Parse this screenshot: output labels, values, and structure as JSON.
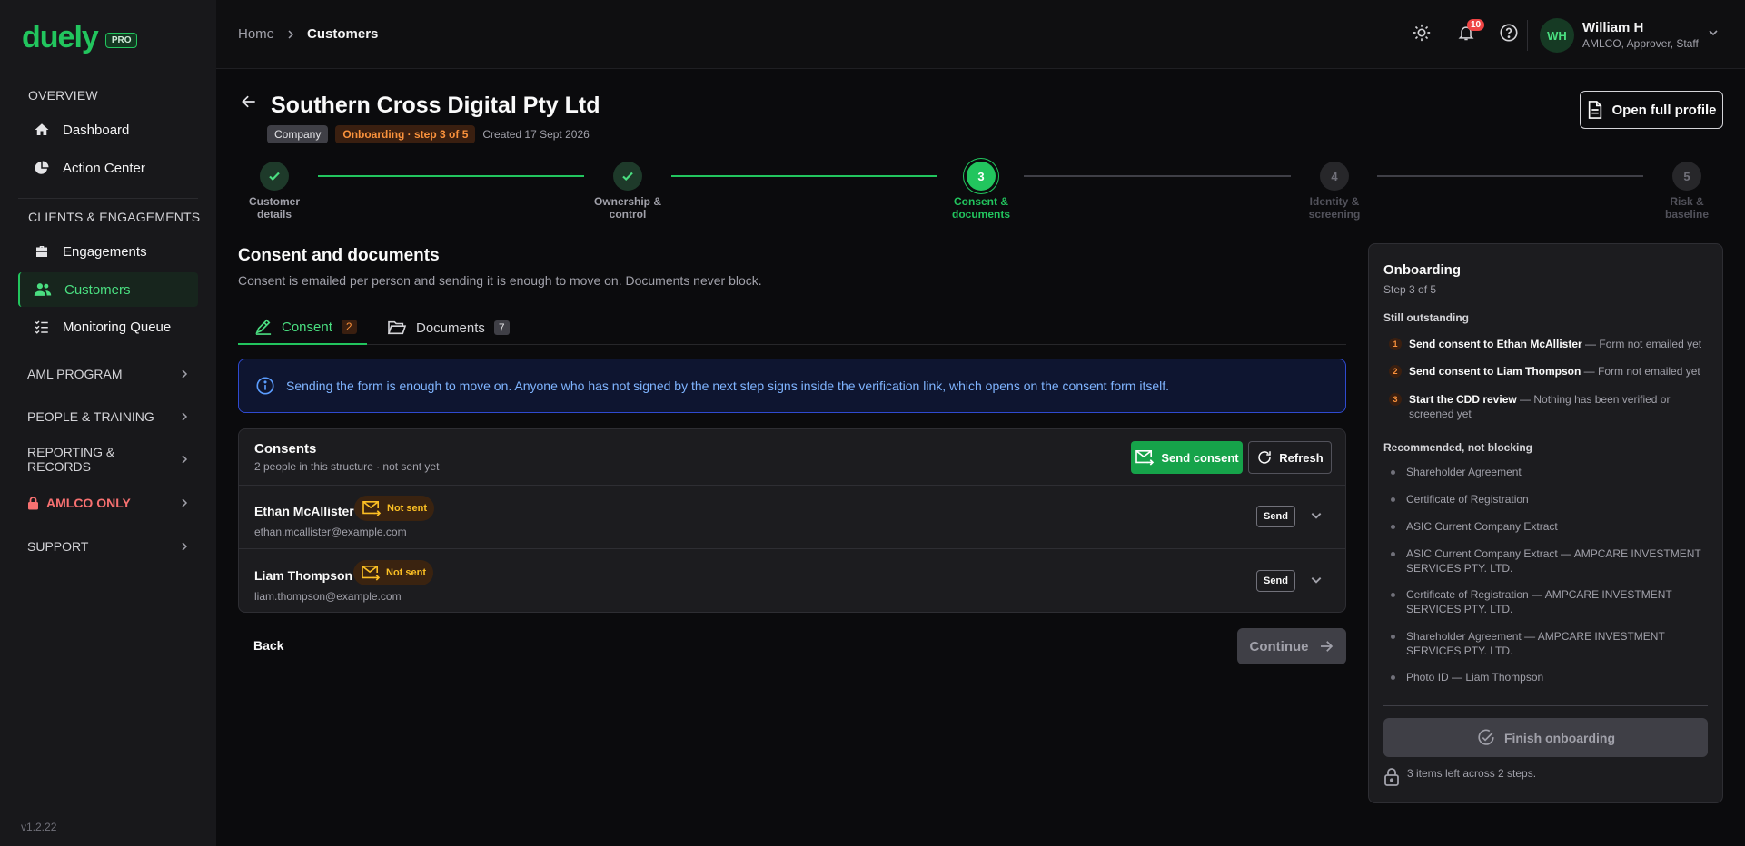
{
  "app": {
    "logo": "duely",
    "plan_badge": "PRO",
    "version": "v1.2.22"
  },
  "sidebar": {
    "overview_label": "OVERVIEW",
    "overview_items": [
      {
        "label": "Dashboard",
        "icon": "home-icon"
      },
      {
        "label": "Action Center",
        "icon": "pie-chart-icon"
      }
    ],
    "clients_label": "CLIENTS & ENGAGEMENTS",
    "clients_items": [
      {
        "label": "Engagements",
        "icon": "briefcase-icon"
      },
      {
        "label": "Customers",
        "icon": "users-icon",
        "active": true
      },
      {
        "label": "Monitoring Queue",
        "icon": "list-check-icon"
      }
    ],
    "groups": [
      {
        "label": "AML PROGRAM"
      },
      {
        "label": "PEOPLE & TRAINING"
      },
      {
        "label": "REPORTING & RECORDS"
      },
      {
        "label": "AMLCO ONLY",
        "locked": true
      },
      {
        "label": "SUPPORT"
      }
    ]
  },
  "header": {
    "breadcrumb": [
      "Home",
      "Customers"
    ],
    "notification_count": "10",
    "user": {
      "initials": "WH",
      "name": "William H",
      "roles": "AMLCO, Approver, Staff"
    }
  },
  "customer": {
    "name": "Southern Cross Digital Pty Ltd",
    "type": "Company",
    "status": "Onboarding · step 3 of 5",
    "created": "Created 17 Sept 2026",
    "open_profile_label": "Open full profile"
  },
  "stepper": {
    "steps": [
      {
        "number": "1",
        "label_line1": "Customer",
        "label_line2": "details",
        "state": "done"
      },
      {
        "number": "2",
        "label_line1": "Ownership &",
        "label_line2": "control",
        "state": "done"
      },
      {
        "number": "3",
        "label_line1": "Consent &",
        "label_line2": "documents",
        "state": "current"
      },
      {
        "number": "4",
        "label_line1": "Identity &",
        "label_line2": "screening",
        "state": "todo"
      },
      {
        "number": "5",
        "label_line1": "Risk &",
        "label_line2": "baseline",
        "state": "todo"
      }
    ]
  },
  "section": {
    "title": "Consent and documents",
    "subtitle": "Consent is emailed per person and sending it is enough to move on. Documents never block.",
    "tabs": [
      {
        "label": "Consent",
        "count": "2",
        "active": true
      },
      {
        "label": "Documents",
        "count": "7",
        "active": false
      }
    ],
    "info_banner": "Sending the form is enough to move on. Anyone who has not signed by the next step signs inside the verification link, which opens on the consent form itself."
  },
  "consents": {
    "title": "Consents",
    "subtitle": "2 people in this structure · not sent yet",
    "send_consent_label": "Send consent",
    "refresh_label": "Refresh",
    "people": [
      {
        "name": "Ethan McAllister",
        "status": "Not sent",
        "email": "ethan.mcallister@example.com",
        "send_label": "Send"
      },
      {
        "name": "Liam Thompson",
        "status": "Not sent",
        "email": "liam.thompson@example.com",
        "send_label": "Send"
      }
    ]
  },
  "footer": {
    "back_label": "Back",
    "continue_label": "Continue"
  },
  "panel": {
    "title": "Onboarding",
    "subtitle": "Step 3 of 5",
    "outstanding_heading": "Still outstanding",
    "outstanding": [
      {
        "num": "1",
        "title": "Send consent to Ethan McAllister",
        "detail": " — Form not emailed yet"
      },
      {
        "num": "2",
        "title": "Send consent to Liam Thompson",
        "detail": " — Form not emailed yet"
      },
      {
        "num": "3",
        "title": "Start the CDD review",
        "detail": " — Nothing has been verified or screened yet"
      }
    ],
    "recommended_heading": "Recommended, not blocking",
    "recommended": [
      "Shareholder Agreement",
      "Certificate of Registration",
      "ASIC Current Company Extract",
      "ASIC Current Company Extract — AMPCARE INVESTMENT SERVICES PTY. LTD.",
      "Certificate of Registration — AMPCARE INVESTMENT SERVICES PTY. LTD.",
      "Shareholder Agreement — AMPCARE INVESTMENT SERVICES PTY. LTD.",
      "Photo ID — Liam Thompson"
    ],
    "finish_label": "Finish onboarding",
    "footer_note": "3 items left across 2 steps."
  },
  "colors": {
    "accent": "#22c55e",
    "warning": "#fb923c",
    "danger": "#ef4444",
    "info": "#2f4ad0",
    "background": "#0b0b0d",
    "surface": "#1c1c1f"
  }
}
